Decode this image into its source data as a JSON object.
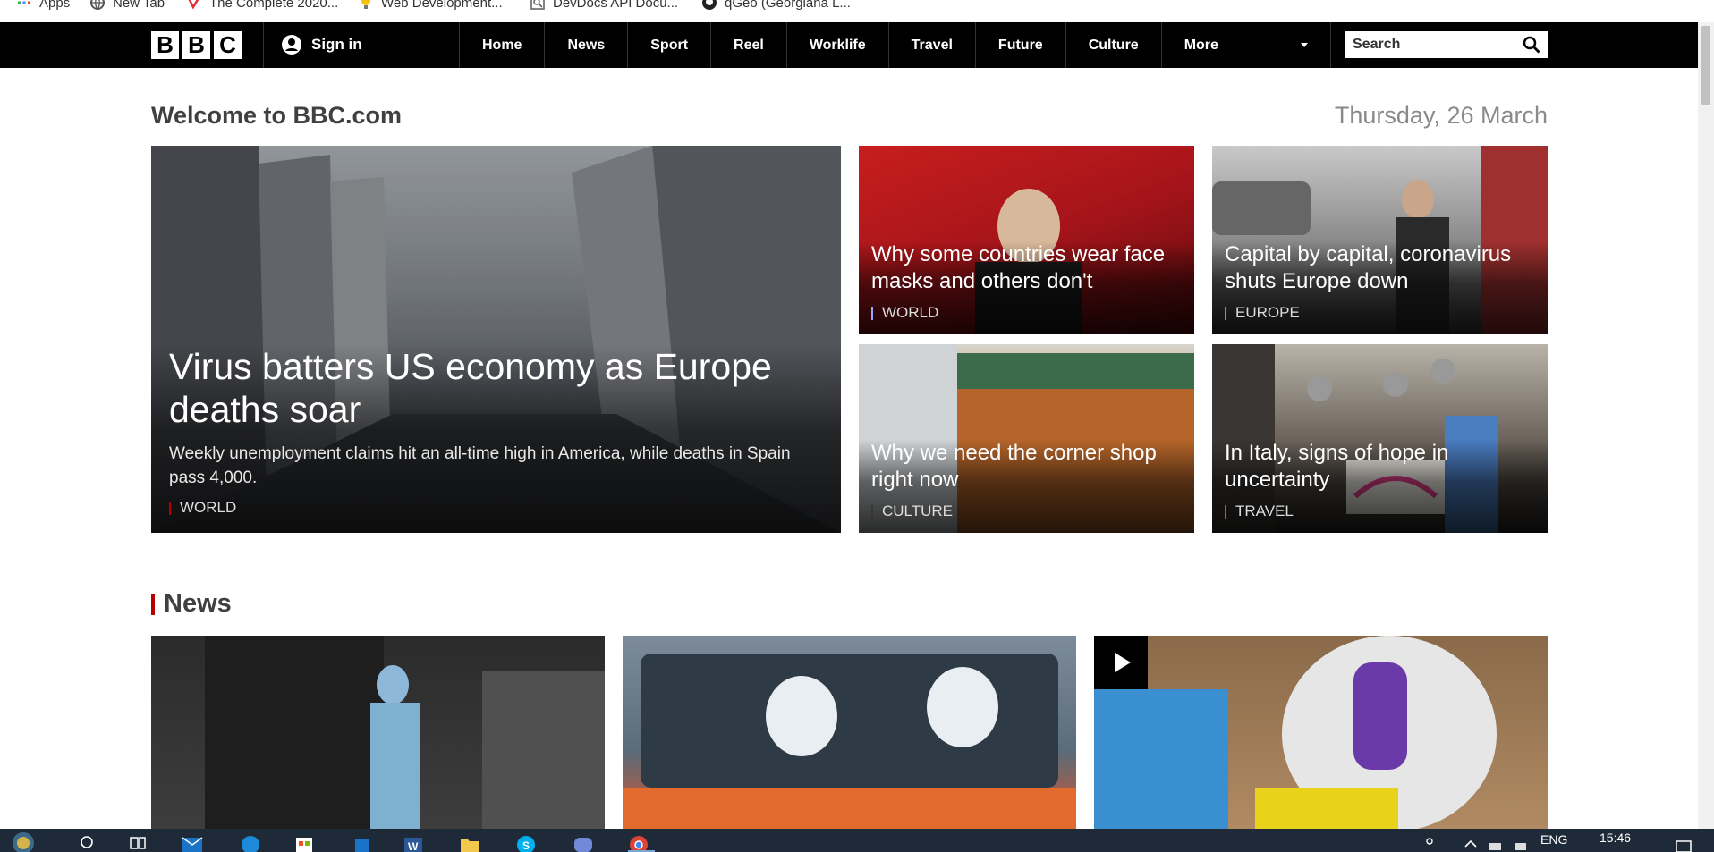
{
  "bookmarks": [
    {
      "label": "Apps",
      "icon": "apps-grid-icon"
    },
    {
      "label": "New Tab",
      "icon": "globe-icon"
    },
    {
      "label": "The Complete 2020...",
      "icon": "udemy-icon"
    },
    {
      "label": "Web Development...",
      "icon": "bulb-icon"
    },
    {
      "label": "DevDocs API Docu...",
      "icon": "devdocs-icon"
    },
    {
      "label": "qGeo (Georgiana L...",
      "icon": "github-icon"
    }
  ],
  "nav": {
    "logo": [
      "B",
      "B",
      "C"
    ],
    "signin": "Sign in",
    "items": [
      "Home",
      "News",
      "Sport",
      "Reel",
      "Worklife",
      "Travel",
      "Future",
      "Culture"
    ],
    "more": "More",
    "search_placeholder": "Search"
  },
  "header": {
    "welcome": "Welcome to BBC.com",
    "date": "Thursday, 26 March"
  },
  "hero": {
    "title": "Virus batters US economy as Europe deaths soar",
    "summary": "Weekly unemployment claims hit an all-time high in America, while deaths in Spain pass 4,000.",
    "tag": "WORLD",
    "tag_color": "#b80000"
  },
  "stories": [
    {
      "title": "Why some countries wear face masks and others don't",
      "tag": "WORLD",
      "tag_color": "#9aa6ff"
    },
    {
      "title": "Capital by capital, coronavirus shuts Europe down",
      "tag": "EUROPE",
      "tag_color": "#5a9bd5"
    },
    {
      "title": "Why we need the corner shop right now",
      "tag": "CULTURE",
      "tag_color": "#333333"
    },
    {
      "title": "In Italy, signs of hope in uncertainty",
      "tag": "TRAVEL",
      "tag_color": "#2e9e3a"
    }
  ],
  "news": {
    "heading": "News",
    "accent": "#b80000"
  },
  "taskbar": {
    "language": "ENG",
    "time": "15:46"
  }
}
